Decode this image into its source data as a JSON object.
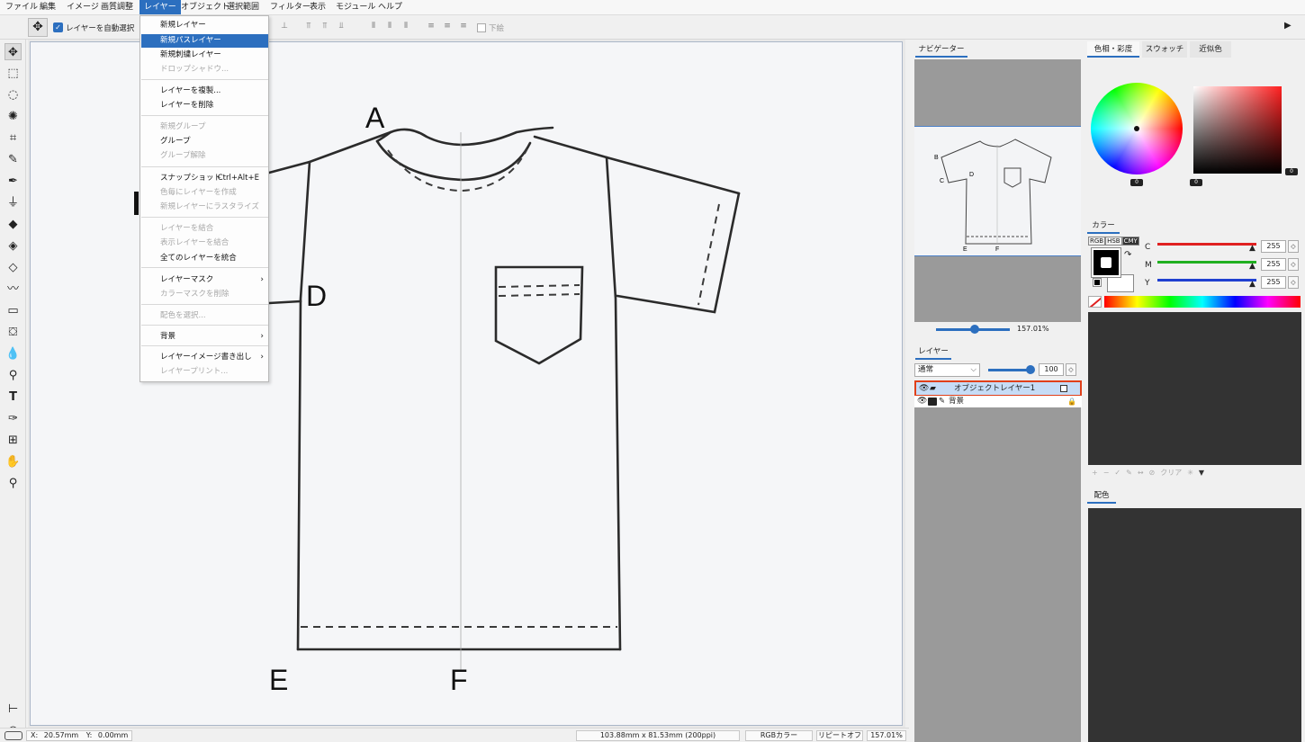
{
  "menubar": {
    "items": [
      "ファイル",
      "編集",
      "イメージ",
      "画質調整",
      "レイヤー",
      "オブジェクト",
      "選択範囲",
      "フィルター",
      "表示",
      "モジュール",
      "ヘルプ"
    ],
    "active": "レイヤー"
  },
  "toolbar": {
    "auto_select_label": "レイヤーを自動選択",
    "auto_select_checked": true,
    "underlay_label": "下絵"
  },
  "layer_menu": {
    "items": [
      {
        "label": "新規レイヤー",
        "state": "enabled"
      },
      {
        "label": "新規パスレイヤー",
        "state": "highlight"
      },
      {
        "label": "新規刺繍レイヤー",
        "state": "enabled"
      },
      {
        "label": "ドロップシャドウ...",
        "state": "disabled"
      },
      {
        "label": "レイヤーを複製...",
        "state": "enabled"
      },
      {
        "label": "レイヤーを削除",
        "state": "enabled"
      },
      {
        "label": "新規グループ",
        "state": "disabled"
      },
      {
        "label": "グループ",
        "state": "enabled"
      },
      {
        "label": "グループ解除",
        "state": "disabled"
      },
      {
        "label": "スナップショット",
        "state": "enabled",
        "shortcut": "Ctrl+Alt+E"
      },
      {
        "label": "色毎にレイヤーを作成",
        "state": "disabled"
      },
      {
        "label": "新規レイヤーにラスタライズ",
        "state": "disabled"
      },
      {
        "label": "レイヤーを結合",
        "state": "disabled"
      },
      {
        "label": "表示レイヤーを結合",
        "state": "disabled"
      },
      {
        "label": "全てのレイヤーを統合",
        "state": "enabled"
      },
      {
        "label": "レイヤーマスク",
        "state": "enabled",
        "submenu": true
      },
      {
        "label": "カラーマスクを削除",
        "state": "disabled"
      },
      {
        "label": "配色を選択...",
        "state": "disabled"
      },
      {
        "label": "背景",
        "state": "enabled",
        "submenu": true
      },
      {
        "label": "レイヤーイメージ書き出し",
        "state": "enabled",
        "submenu": true
      },
      {
        "label": "レイヤープリント...",
        "state": "disabled"
      }
    ]
  },
  "canvas": {
    "labels": [
      "A",
      "D",
      "E",
      "F"
    ]
  },
  "statusbar": {
    "x_label": "X:",
    "x_value": "20.57mm",
    "y_label": "Y:",
    "y_value": "0.00mm",
    "size": "103.88mm x 81.53mm (200ppi)",
    "color_mode": "RGBカラー",
    "repeat": "リピートオフ",
    "zoom": "157.01%"
  },
  "navigator": {
    "tab": "ナビゲーター",
    "zoom": "157.01%",
    "thumb_labels": [
      "B",
      "D",
      "C",
      "E",
      "F"
    ]
  },
  "layers": {
    "tab": "レイヤー",
    "blend_mode": "通常",
    "opacity": "100",
    "rows": [
      {
        "name": "オブジェクトレイヤー1",
        "selected": true
      },
      {
        "name": "背景",
        "selected": false
      }
    ]
  },
  "color_tabs": {
    "items": [
      "色相・彩度",
      "スウォッチ",
      "近似色"
    ],
    "active": "色相・彩度",
    "wheel_value": "0",
    "square_values": [
      "0",
      "0"
    ]
  },
  "color_panel": {
    "tab": "カラー",
    "modes": [
      "RGB",
      "HSB",
      "CMY"
    ],
    "active_mode": "CMY",
    "channels": [
      {
        "name": "C",
        "value": "255",
        "color": "#e02020"
      },
      {
        "name": "M",
        "value": "255",
        "color": "#20b020"
      },
      {
        "name": "Y",
        "value": "255",
        "color": "#2040d0"
      }
    ],
    "palette_toolbar": [
      "+",
      "−",
      "✓",
      "✎",
      "↔",
      "⊘",
      "クリア",
      "✳",
      "▼"
    ]
  },
  "haishoku": {
    "tab": "配色"
  }
}
